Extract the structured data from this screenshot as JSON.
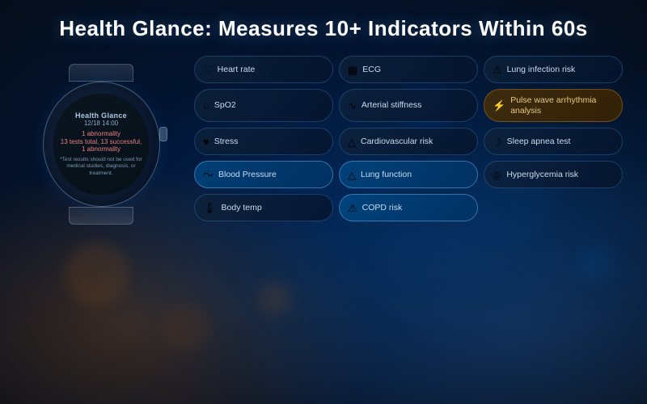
{
  "page": {
    "title": "Health Glance: Measures 10+ Indicators Within 60s",
    "background_colors": {
      "primary": "#050d1a",
      "accent_blue": "#003c78",
      "accent_gold": "#b46414"
    }
  },
  "watch": {
    "brand": "Health Glance",
    "datetime": "12/18 14:00",
    "abnormality_count": "1 abnormality",
    "abnormality_detail": "13 tests total, 13 successful, 1 abnormality",
    "disclaimer": "*Test results should not be used for medical studies, diagnosis, or treatment."
  },
  "indicators": [
    {
      "id": "heart-rate",
      "icon": "♡",
      "label": "Heart rate",
      "highlighted": false,
      "amber": false
    },
    {
      "id": "ecg",
      "icon": "▦",
      "label": "ECG",
      "highlighted": false,
      "amber": false
    },
    {
      "id": "lung-infection-risk",
      "icon": "⚠",
      "label": "Lung infection risk",
      "highlighted": false,
      "amber": false
    },
    {
      "id": "spo2",
      "icon": "○",
      "label": "SpO2",
      "highlighted": false,
      "amber": false
    },
    {
      "id": "arterial-stiffness",
      "icon": "∿",
      "label": "Arterial stiffness",
      "highlighted": false,
      "amber": false
    },
    {
      "id": "pulse-wave",
      "icon": "⚡",
      "label": "Pulse wave arrhythmia analysis",
      "highlighted": false,
      "amber": true
    },
    {
      "id": "stress",
      "icon": "♥",
      "label": "Stress",
      "highlighted": false,
      "amber": false
    },
    {
      "id": "cardiovascular-risk",
      "icon": "△",
      "label": "Cardiovascular risk",
      "highlighted": false,
      "amber": false
    },
    {
      "id": "sleep-apnea",
      "icon": "☽",
      "label": "Sleep apnea test",
      "highlighted": false,
      "amber": false
    },
    {
      "id": "blood-pressure",
      "icon": "〜",
      "label": "Blood Pressure",
      "highlighted": true,
      "amber": false
    },
    {
      "id": "lung-function",
      "icon": "△",
      "label": "Lung function",
      "highlighted": true,
      "amber": false
    },
    {
      "id": "hyperglycemia-risk",
      "icon": "◎",
      "label": "Hyperglycemia risk",
      "highlighted": false,
      "amber": false
    },
    {
      "id": "body-temp",
      "icon": "🌡",
      "label": "Body temp",
      "highlighted": false,
      "amber": false
    },
    {
      "id": "copd-risk",
      "icon": "⚠",
      "label": "COPD risk",
      "highlighted": true,
      "amber": false
    }
  ]
}
